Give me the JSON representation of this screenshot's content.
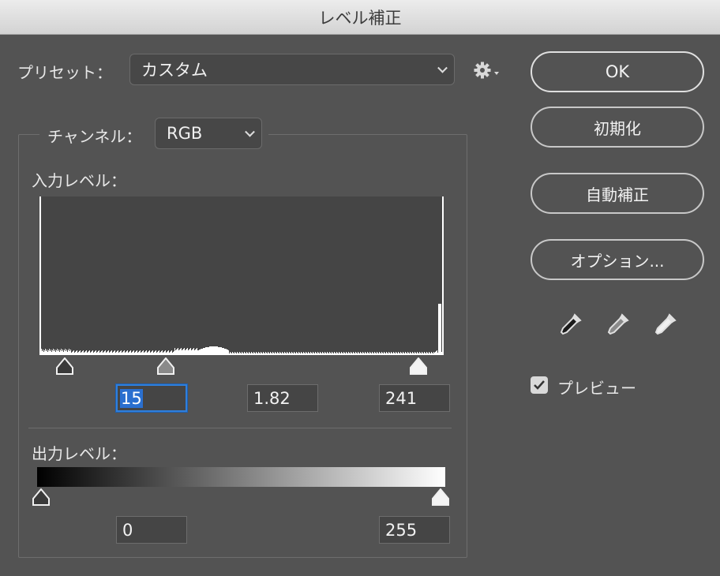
{
  "window": {
    "title": "レベル補正"
  },
  "preset": {
    "label": "プリセット：",
    "value": "カスタム"
  },
  "channel": {
    "label": "チャンネル：",
    "value": "RGB"
  },
  "input_levels": {
    "label": "入力レベル：",
    "black": "15",
    "gamma": "1.82",
    "white": "241"
  },
  "output_levels": {
    "label": "出力レベル：",
    "black": "0",
    "white": "255"
  },
  "buttons": {
    "ok": "OK",
    "reset": "初期化",
    "auto": "自動補正",
    "options": "オプション..."
  },
  "preview": {
    "label": "プレビュー",
    "checked": true
  },
  "icons": {
    "settings": "gear-icon",
    "black_eyedropper": "black-eyedropper-icon",
    "gray_eyedropper": "gray-eyedropper-icon",
    "white_eyedropper": "white-eyedropper-icon"
  },
  "colors": {
    "background": "#535353",
    "focus": "#2f7fdc"
  }
}
